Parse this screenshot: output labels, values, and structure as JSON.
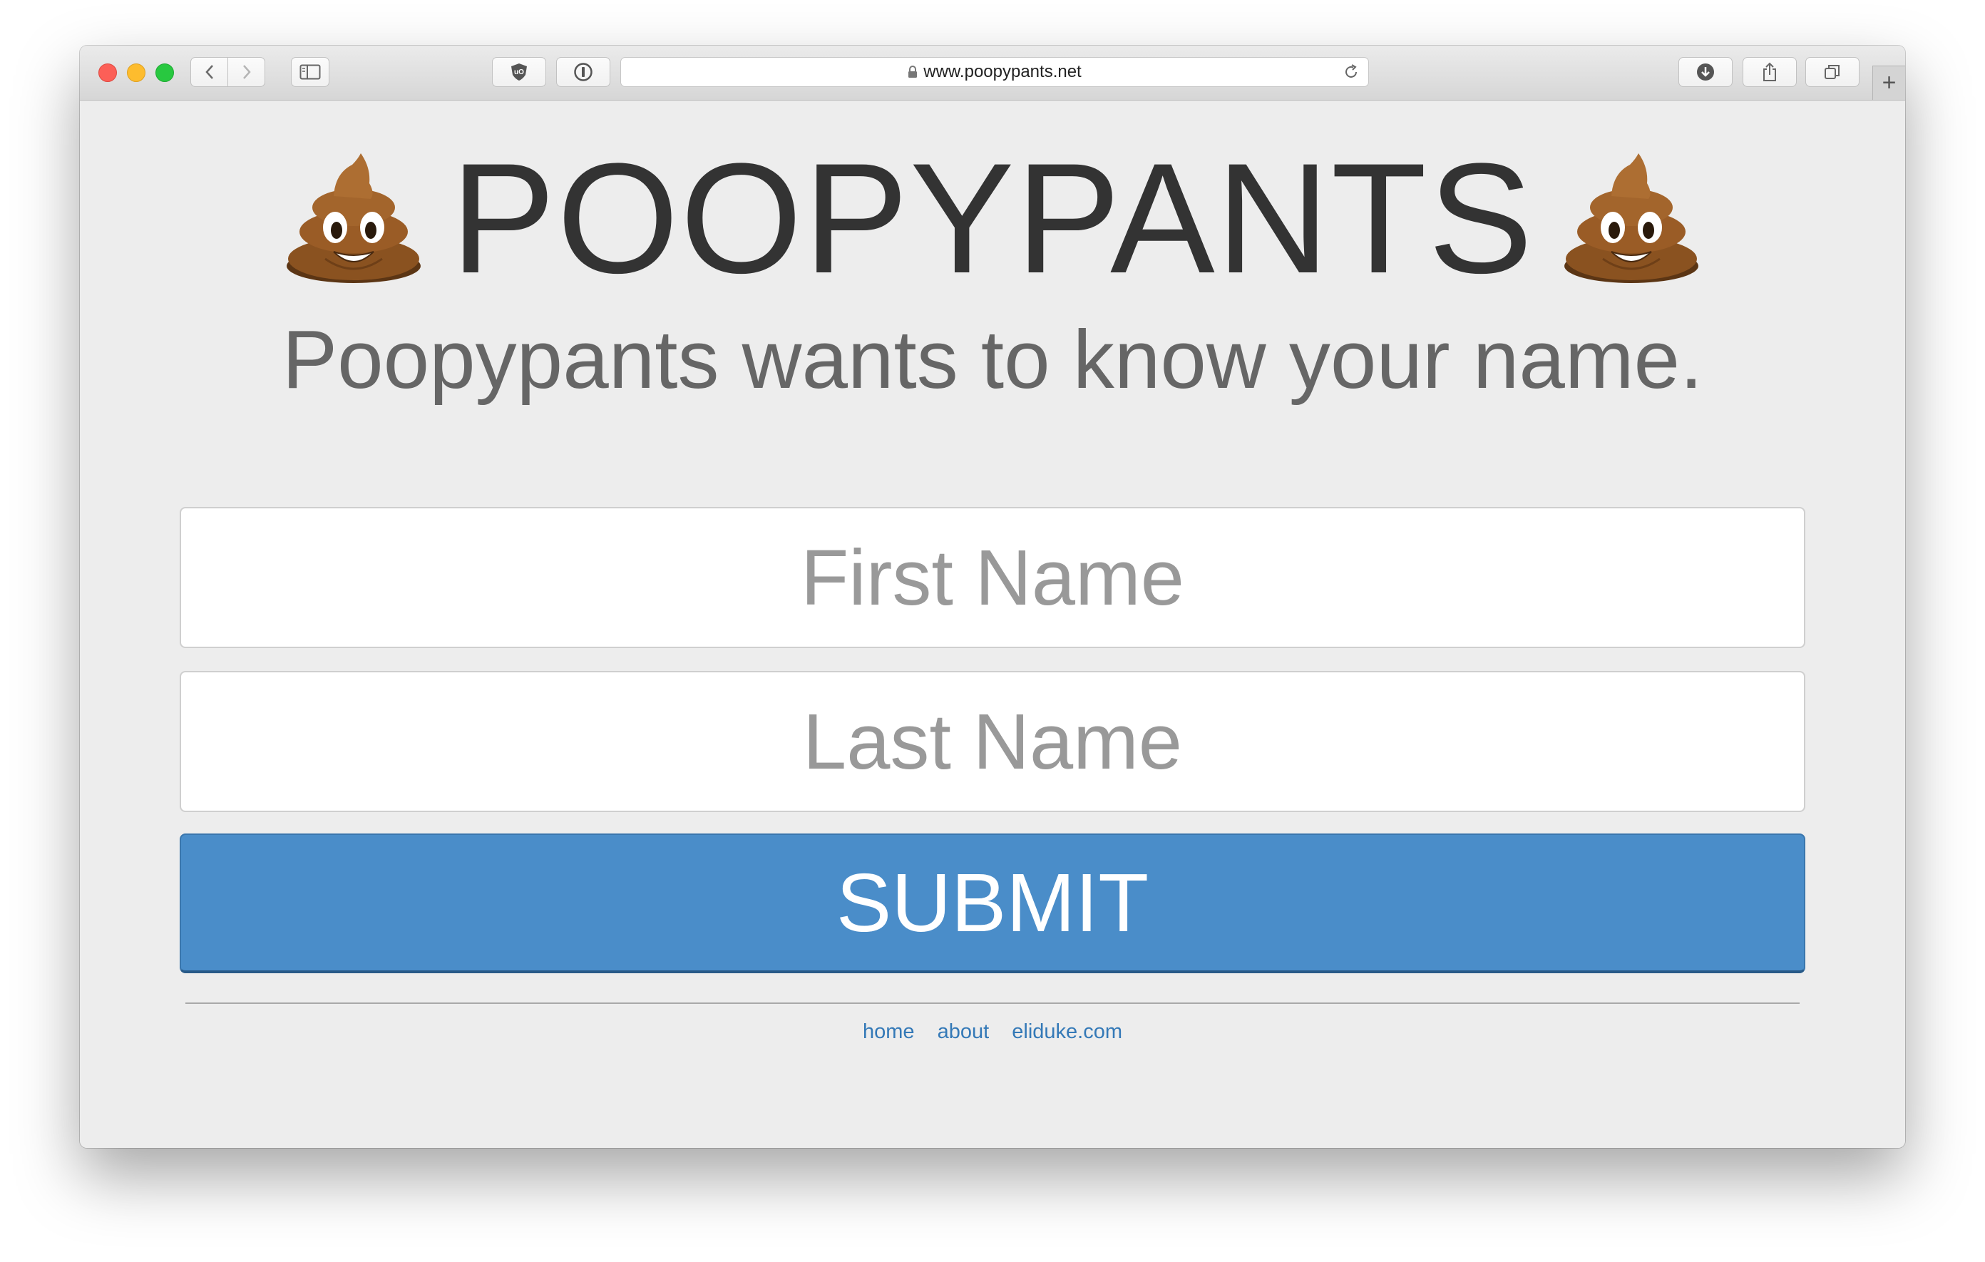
{
  "browser": {
    "url": "www.poopypants.net",
    "new_tab_label": "+",
    "icons": [
      "back-icon",
      "forward-icon",
      "sidebar-icon",
      "ublock-icon",
      "password-icon",
      "lock-icon",
      "reload-icon",
      "download-icon",
      "share-icon",
      "tabs-icon"
    ]
  },
  "page": {
    "title": "POOPYPANTS",
    "title_icon": "poop-emoji-icon",
    "subtitle": "Poopypants wants to know your name.",
    "form": {
      "first_name_placeholder": "First Name",
      "first_name_value": "",
      "last_name_placeholder": "Last Name",
      "last_name_value": "",
      "submit_label": "SUBMIT"
    },
    "footer": {
      "links": [
        "home",
        "about",
        "eliduke.com"
      ]
    },
    "colors": {
      "background": "#ededed",
      "submit": "#4a8dc9",
      "link": "#3479b7",
      "title": "#333333",
      "subtitle": "#666666"
    }
  }
}
